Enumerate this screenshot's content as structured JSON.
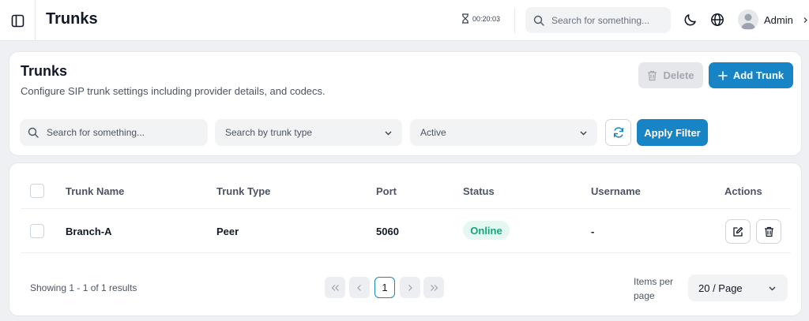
{
  "header": {
    "title": "Trunks",
    "timer": "00:20:03",
    "search_placeholder": "Search for something...",
    "user_name": "Admin"
  },
  "page": {
    "title": "Trunks",
    "subtitle": "Configure SIP trunk settings including provider details, and codecs.",
    "delete_label": "Delete",
    "add_label": "Add Trunk"
  },
  "filters": {
    "search_placeholder": "Search for something...",
    "type_placeholder": "Search by trunk type",
    "status_value": "Active",
    "apply_label": "Apply Filter"
  },
  "table": {
    "columns": [
      "Trunk Name",
      "Trunk Type",
      "Port",
      "Status",
      "Username",
      "Actions"
    ],
    "rows": [
      {
        "name": "Branch-A",
        "type": "Peer",
        "port": "5060",
        "status": "Online",
        "username": "-"
      }
    ]
  },
  "pagination": {
    "showing": "Showing 1 - 1 of 1 results",
    "current_page": "1",
    "items_per_page_label": "Items per page",
    "page_size": "20 / Page"
  },
  "colors": {
    "primary": "#1784c6",
    "success_text": "#16a37a",
    "success_bg": "#e4f8f1"
  }
}
